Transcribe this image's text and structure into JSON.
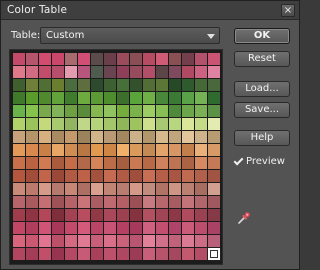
{
  "window": {
    "title": "Color Table",
    "close_icon": "×"
  },
  "table": {
    "label": "Table:",
    "selected": "Custom"
  },
  "buttons": {
    "ok": "OK",
    "reset": "Reset",
    "load": "Load...",
    "save": "Save...",
    "help": "Help"
  },
  "preview": {
    "label": "Preview",
    "checked": true
  },
  "palette": {
    "columns": 16,
    "rows": 16,
    "colors": [
      "#c44a6a",
      "#b5566d",
      "#d24b71",
      "#c8476b",
      "#a86a6f",
      "#d14f74",
      "#5b4b4a",
      "#6b3f49",
      "#9a4c5c",
      "#8a4f54",
      "#b64c63",
      "#cf5b77",
      "#8a4f53",
      "#743f4c",
      "#b3506b",
      "#c95473",
      "#e07a8b",
      "#d26c83",
      "#c34c6b",
      "#b54f6b",
      "#e49bb0",
      "#b7557c",
      "#4f5b4e",
      "#6a4450",
      "#8f3f59",
      "#964c5d",
      "#b24e67",
      "#5c4546",
      "#7f4a5d",
      "#b04a62",
      "#cb6282",
      "#e082a1",
      "#3f5f2f",
      "#6f7f3a",
      "#4f6f34",
      "#6b7e2f",
      "#4b6c3f",
      "#5f6d3f",
      "#2d4a2f",
      "#3d5f31",
      "#476f39",
      "#34512d",
      "#526d35",
      "#5c7638",
      "#264927",
      "#2f5a2d",
      "#466837",
      "#49683b",
      "#3e7a2a",
      "#5a9c2c",
      "#4f8a2f",
      "#63a13a",
      "#3f7c2e",
      "#6eab3f",
      "#5b9a35",
      "#4d8d2e",
      "#3b6f2b",
      "#5aa43b",
      "#6fb046",
      "#49883a",
      "#3a7a35",
      "#5aa247",
      "#74b355",
      "#2f6a2e",
      "#6ab24a",
      "#86c24e",
      "#7aa84c",
      "#82b35a",
      "#6f9f43",
      "#5a8c3b",
      "#87b84f",
      "#90c25f",
      "#74ad3c",
      "#7cb24b",
      "#9ccc63",
      "#88bf55",
      "#4f8a3a",
      "#6ca54a",
      "#7cb055",
      "#5b9246",
      "#b1d26a",
      "#9ac35c",
      "#c4d97c",
      "#a8c96f",
      "#93b561",
      "#c0d78a",
      "#b6d47a",
      "#a4c56a",
      "#8fb659",
      "#9ec45f",
      "#cfe08d",
      "#a9c873",
      "#b8d57f",
      "#dbe69a",
      "#c6db88",
      "#e4ebb0",
      "#c7a27a",
      "#b49468",
      "#d8b07f",
      "#a98a62",
      "#c49a6d",
      "#9b845c",
      "#d1b487",
      "#ba9a74",
      "#a3875f",
      "#ccb08a",
      "#b3976c",
      "#d7b98e",
      "#c1a57c",
      "#e2c59a",
      "#cdb28c",
      "#b79b73",
      "#e39a58",
      "#d9894d",
      "#c88047",
      "#e7a665",
      "#d18c52",
      "#b97744",
      "#e1984f",
      "#cd8646",
      "#f0b06a",
      "#d99a5b",
      "#c48a55",
      "#e3a46c",
      "#d79663",
      "#c27f4c",
      "#e9b07a",
      "#d69a66",
      "#c7704a",
      "#b96343",
      "#d07b52",
      "#a85b3d",
      "#c56d48",
      "#b2694a",
      "#d48458",
      "#bb6d47",
      "#a55e40",
      "#c97a53",
      "#b76a45",
      "#cf835d",
      "#be7352",
      "#aa6344",
      "#d78a62",
      "#c47a57",
      "#b5573f",
      "#a24d3a",
      "#c26449",
      "#9a4838",
      "#b25a44",
      "#bd6249",
      "#a4513d",
      "#c56b52",
      "#b15b45",
      "#9f4f3c",
      "#c86e55",
      "#b65f48",
      "#a85641",
      "#c06a52",
      "#b1614b",
      "#a05443",
      "#c98a7a",
      "#bb7a6b",
      "#d69a88",
      "#b57a6d",
      "#c88676",
      "#ad6f63",
      "#d9a08f",
      "#c28475",
      "#b87d70",
      "#d49989",
      "#c18b7e",
      "#b07366",
      "#cf9584",
      "#bc8072",
      "#a86c60",
      "#d2a091",
      "#b7656a",
      "#a85a5f",
      "#c56f74",
      "#9d5257",
      "#b56268",
      "#c87479",
      "#a95d62",
      "#bf6a70",
      "#b35f65",
      "#9b5055",
      "#c77a7f",
      "#b7686d",
      "#a65c61",
      "#c2747a",
      "#b1666b",
      "#a05a5f",
      "#a03c4c",
      "#8e3442",
      "#b34758",
      "#7f2f3c",
      "#a24252",
      "#b84d5f",
      "#923946",
      "#a9485a",
      "#9d4151",
      "#863340",
      "#b1505f",
      "#a04556",
      "#8c3846",
      "#b04b5d",
      "#9a4251",
      "#863947",
      "#c24767",
      "#b13d5c",
      "#cf5476",
      "#a8385a",
      "#c44a6c",
      "#d45a7c",
      "#b94465",
      "#c75375",
      "#b64063",
      "#a53a5b",
      "#d0607f",
      "#c34f70",
      "#b0436a",
      "#cc5b7a",
      "#bc4d6d",
      "#a94265",
      "#d8657b",
      "#c95870",
      "#e17490",
      "#bd5069",
      "#d46a82",
      "#e07a94",
      "#c85f78",
      "#d97089",
      "#cb627b",
      "#b85570",
      "#e3819a",
      "#d0708a",
      "#c06279",
      "#db7b93",
      "#cd6d85",
      "#b8607a",
      "#b2455f",
      "#a33c56",
      "#c24f6a",
      "#973550",
      "#b54862",
      "#c75a74",
      "#a94059",
      "#bd516b",
      "#b04760",
      "#9c3b55",
      "#c85f78",
      "#b7536b",
      "#a4475f",
      "#c2596f",
      "#b24e66",
      "#ffffff"
    ]
  }
}
